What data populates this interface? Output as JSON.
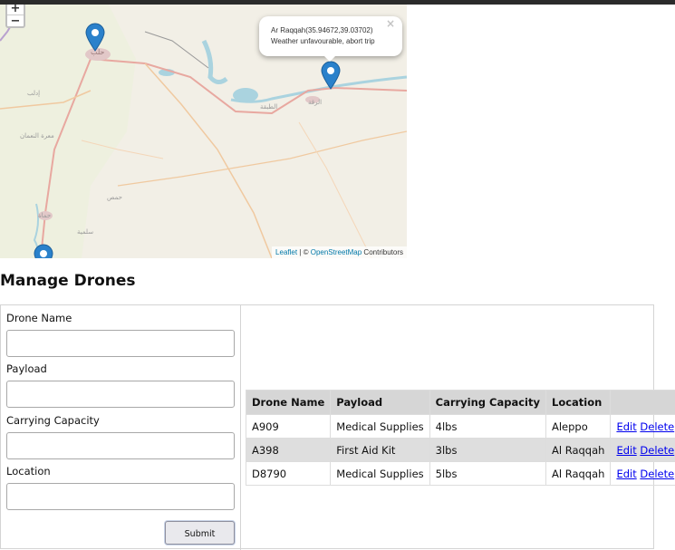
{
  "map": {
    "zoom_in": "+",
    "zoom_out": "−",
    "popup": {
      "line1": "Ar Raqqah(35.94672,39.03702)",
      "line2": "Weather unfavourable, abort trip",
      "close": "×"
    },
    "markers": [
      "Aleppo",
      "Ar Raqqah",
      "Hama"
    ],
    "attribution": {
      "leaflet": "Leaflet",
      "sep": " | © ",
      "osm": "OpenStreetMap",
      "contributors": " Contributors"
    },
    "place_labels": [
      "حلب",
      "إدلب",
      "معرة النعمان",
      "حماة",
      "سلمية",
      "حمص",
      "الطبقة",
      "الرقة"
    ]
  },
  "heading": "Manage Drones",
  "form": {
    "fields": [
      {
        "label": "Drone Name",
        "value": ""
      },
      {
        "label": "Payload",
        "value": ""
      },
      {
        "label": "Carrying Capacity",
        "value": ""
      },
      {
        "label": "Location",
        "value": ""
      }
    ],
    "submit": "Submit"
  },
  "table": {
    "headers": [
      "Drone Name",
      "Payload",
      "Carrying Capacity",
      "Location",
      ""
    ],
    "rows": [
      {
        "name": "A909",
        "payload": "Medical Supplies",
        "capacity": "4lbs",
        "location": "Aleppo",
        "edit": "Edit",
        "delete": "Delete"
      },
      {
        "name": "A398",
        "payload": "First Aid Kit",
        "capacity": "3lbs",
        "location": "Al Raqqah",
        "edit": "Edit",
        "delete": "Delete"
      },
      {
        "name": "D8790",
        "payload": "Medical Supplies",
        "capacity": "5lbs",
        "location": "Al Raqqah",
        "edit": "Edit",
        "delete": "Delete"
      }
    ]
  },
  "colors": {
    "marker": "#2a81cb",
    "water": "#aad3df",
    "land": "#f2efe6",
    "link": "#0000ee",
    "table_header": "#d6d6d6"
  }
}
